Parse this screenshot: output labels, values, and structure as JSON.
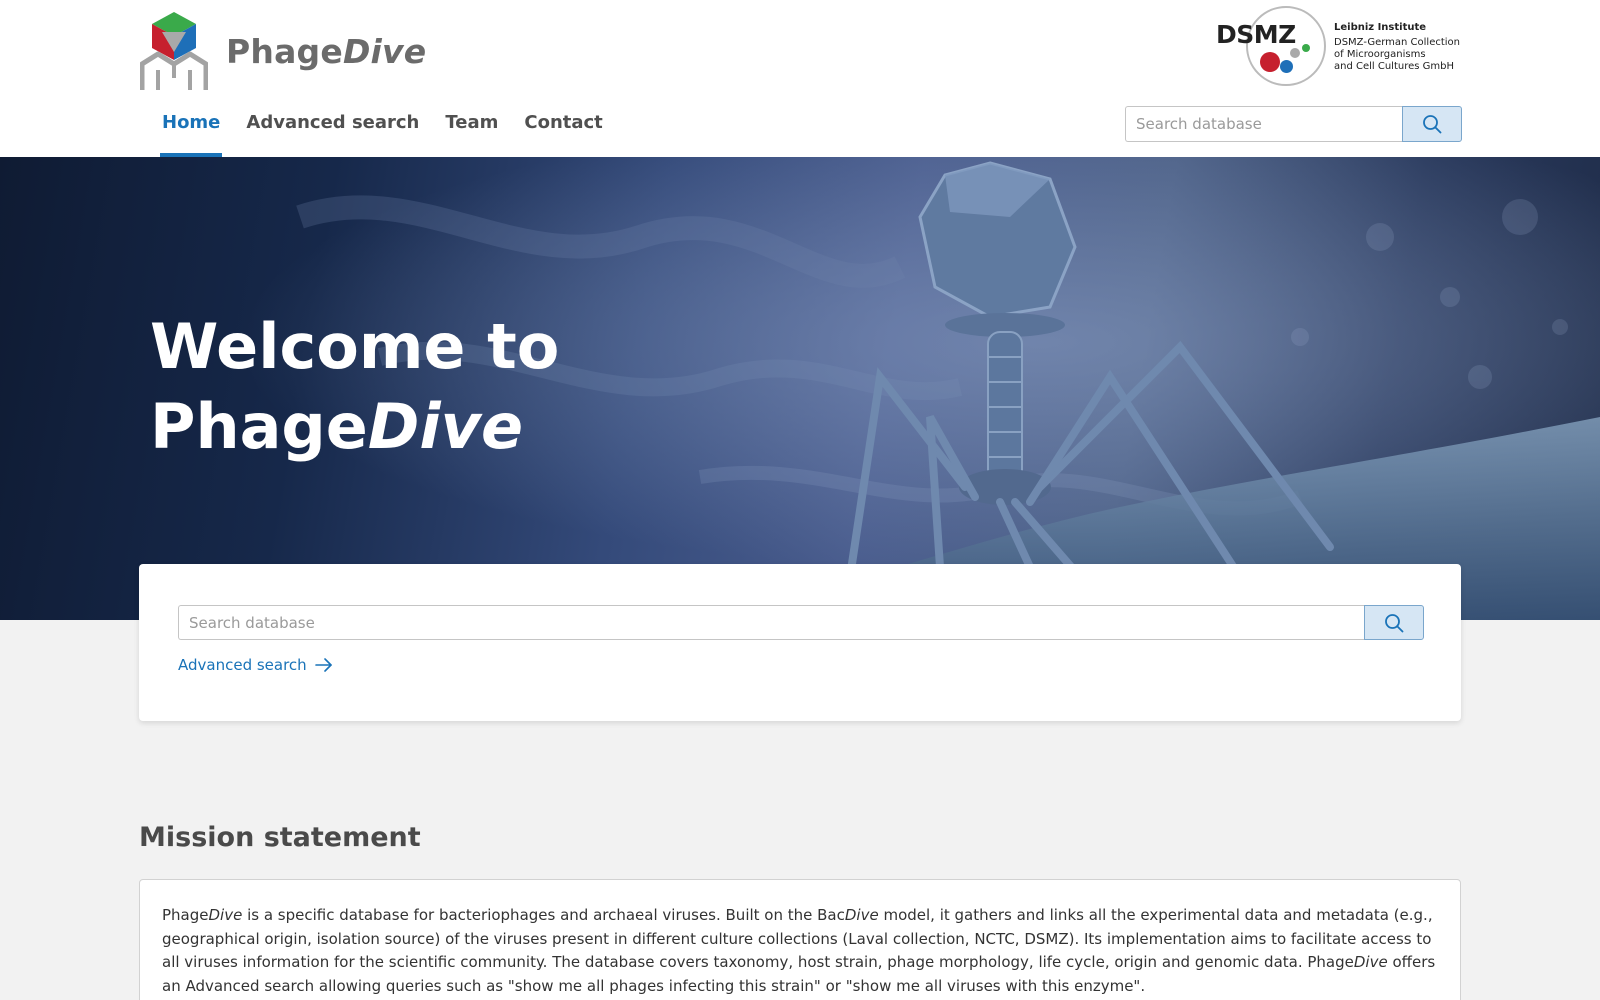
{
  "header": {
    "brand_prefix": "Phage",
    "brand_suffix": "Dive",
    "dsmz": {
      "wordmark": "DSMZ",
      "line1": "Leibniz Institute",
      "line2": "DSMZ-German Collection",
      "line3": "of Microorganisms",
      "line4": "and Cell Cultures GmbH"
    },
    "search_placeholder": "Search database"
  },
  "nav": {
    "items": [
      {
        "label": "Home",
        "active": true
      },
      {
        "label": "Advanced search",
        "active": false
      },
      {
        "label": "Team",
        "active": false
      },
      {
        "label": "Contact",
        "active": false
      }
    ]
  },
  "hero": {
    "line1": "Welcome to",
    "line2_prefix": "Phage",
    "line2_suffix": "Dive"
  },
  "search_card": {
    "placeholder": "Search database",
    "advanced_link": "Advanced search"
  },
  "mission": {
    "heading": "Mission statement",
    "t1": "Phage",
    "t2": "Dive",
    "t3": " is a specific database for bacteriophages and archaeal viruses. Built on the Bac",
    "t4": "Dive",
    "t5": " model, it gathers and links all the experimental data and metadata (e.g., geographical origin, isolation source) of the viruses present in different culture collections (Laval collection, NCTC, DSMZ). Its implementation aims to facilitate access to all viruses information for the scientific community. The database covers taxonomy, host strain, phage morphology, life cycle, origin and genomic data. Phage",
    "t6": "Dive",
    "t7": " offers an Advanced search allowing queries such as \"show me all phages infecting this strain\" or \"show me all viruses with this enzyme\"."
  },
  "icons": {
    "search": "search-icon",
    "arrow": "arrow-right-icon",
    "logo": "phagedive-logo-icon"
  },
  "colors": {
    "accent": "#1a73b8",
    "search_button_bg": "#d6e6f4",
    "logo_green": "#3aaa4a",
    "logo_red": "#c6202e",
    "logo_blue": "#1e6fb8"
  }
}
